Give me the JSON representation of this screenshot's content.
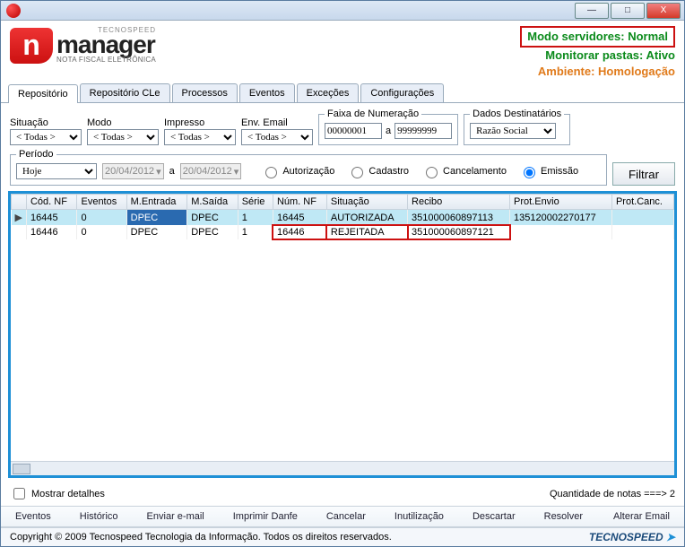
{
  "titlebar": {
    "min": "—",
    "max": "□",
    "close": "X"
  },
  "logo": {
    "mark": "n",
    "sup": "TECNOSPEED",
    "main": "manager",
    "sub": "NOTA FISCAL ELETRÔNICA"
  },
  "status": {
    "line1": "Modo servidores: Normal",
    "line2": "Monitorar pastas: Ativo",
    "line3": "Ambiente: Homologação"
  },
  "tabs": [
    "Repositório",
    "Repositório CLe",
    "Processos",
    "Eventos",
    "Exceções",
    "Configurações"
  ],
  "filters": {
    "situacao": {
      "label": "Situação",
      "value": "< Todas >"
    },
    "modo": {
      "label": "Modo",
      "value": "< Todas >"
    },
    "impresso": {
      "label": "Impresso",
      "value": "< Todas >"
    },
    "envemail": {
      "label": "Env. Email",
      "value": "< Todas >"
    },
    "faixa": {
      "legend": "Faixa de Numeração",
      "from": "00000001",
      "sep": "a",
      "to": "99999999"
    },
    "dest": {
      "legend": "Dados Destinatários",
      "value": "Razão Social"
    },
    "periodo": {
      "legend": "Período",
      "range_value": "Hoje",
      "date_from": "20/04/2012",
      "date_sep": "a",
      "date_to": "20/04/2012",
      "radios": [
        "Autorização",
        "Cadastro",
        "Cancelamento",
        "Emissão"
      ],
      "selected": "Emissão"
    },
    "btn_filtrar": "Filtrar"
  },
  "grid": {
    "headers": [
      "",
      "Cód. NF",
      "Eventos",
      "M.Entrada",
      "M.Saída",
      "Série",
      "Núm. NF",
      "Situação",
      "Recibo",
      "Prot.Envio",
      "Prot.Canc."
    ],
    "rows": [
      {
        "arrow": "▶",
        "cod": "16445",
        "eventos": "0",
        "entrada": "DPEC",
        "saida": "DPEC",
        "serie": "1",
        "num": "16445",
        "situacao": "AUTORIZADA",
        "recibo": "351000060897113",
        "protenvio": "135120002270177",
        "protcanc": ""
      },
      {
        "arrow": "",
        "cod": "16446",
        "eventos": "0",
        "entrada": "DPEC",
        "saida": "DPEC",
        "serie": "1",
        "num": "16446",
        "situacao": "REJEITADA",
        "recibo": "351000060897121",
        "protenvio": "",
        "protcanc": ""
      }
    ]
  },
  "bottom": {
    "detalhes": "Mostrar detalhes",
    "quantidade": "Quantidade de notas ===>  2"
  },
  "actions": [
    "Eventos",
    "Histórico",
    "Enviar e-mail",
    "Imprimir Danfe",
    "Cancelar",
    "Inutilização",
    "Descartar",
    "Resolver",
    "Alterar Email"
  ],
  "footer": {
    "copyright": "Copyright © 2009 Tecnospeed Tecnologia da Informação.  Todos os direitos reservados.",
    "brand": "TECNOSPEED",
    "brand_arrow": " ➤"
  }
}
